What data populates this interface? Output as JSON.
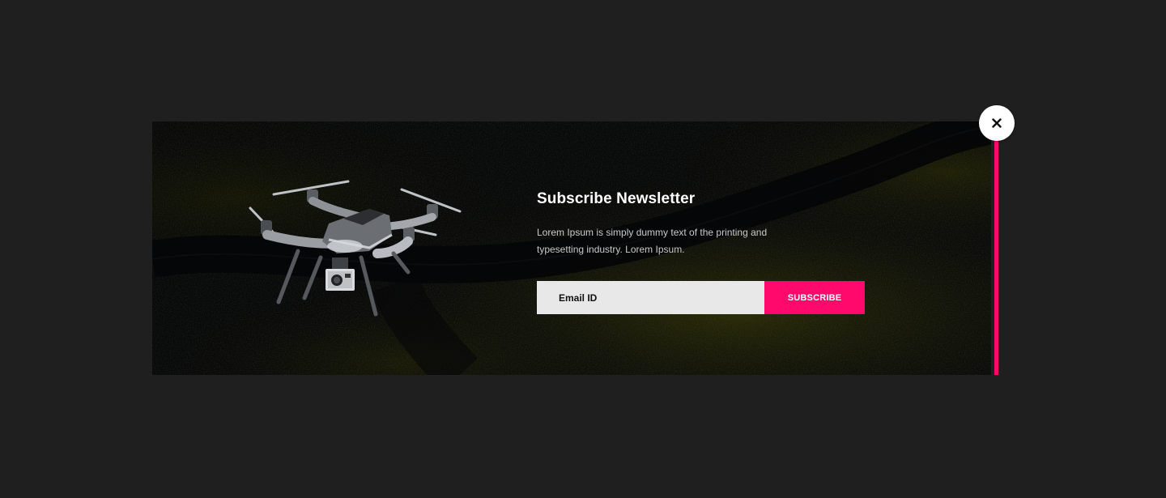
{
  "popup": {
    "title": "Subscribe Newsletter",
    "description": "Lorem Ipsum is simply dummy text of the printing and typesetting industry. Lorem Ipsum.",
    "email_placeholder": "Email ID",
    "email_value": "",
    "subscribe_label": "SUBSCRIBE",
    "close_icon": "close-icon",
    "image": "drone-image"
  },
  "colors": {
    "page_background": "#1f1f1f",
    "accent": "#ff0a6c",
    "close_button": "#ffffff",
    "input_background": "#e8e8e8"
  }
}
